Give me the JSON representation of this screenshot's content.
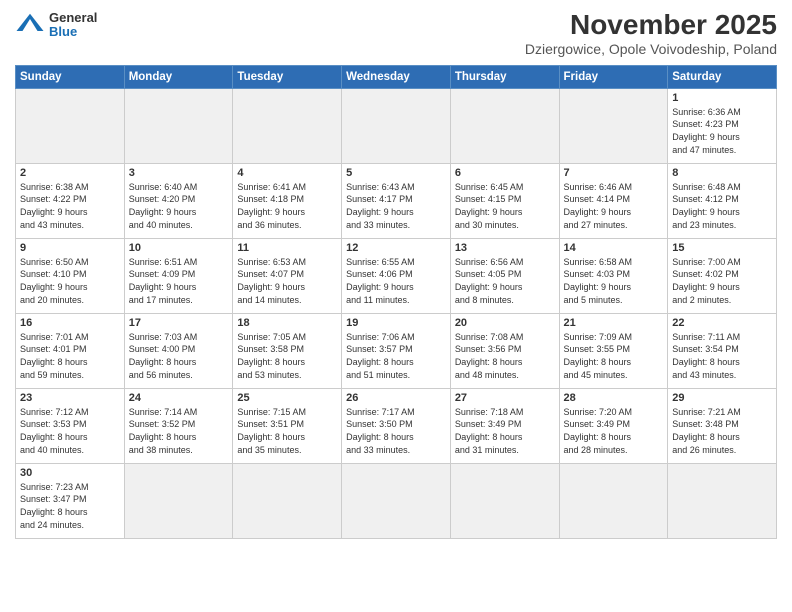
{
  "header": {
    "logo_general": "General",
    "logo_blue": "Blue",
    "month_title": "November 2025",
    "location": "Dziergowice, Opole Voivodeship, Poland"
  },
  "days_of_week": [
    "Sunday",
    "Monday",
    "Tuesday",
    "Wednesday",
    "Thursday",
    "Friday",
    "Saturday"
  ],
  "weeks": [
    {
      "days": [
        {
          "num": "",
          "info": ""
        },
        {
          "num": "",
          "info": ""
        },
        {
          "num": "",
          "info": ""
        },
        {
          "num": "",
          "info": ""
        },
        {
          "num": "",
          "info": ""
        },
        {
          "num": "",
          "info": ""
        },
        {
          "num": "1",
          "info": "Sunrise: 6:36 AM\nSunset: 4:23 PM\nDaylight: 9 hours\nand 47 minutes."
        }
      ]
    },
    {
      "days": [
        {
          "num": "2",
          "info": "Sunrise: 6:38 AM\nSunset: 4:22 PM\nDaylight: 9 hours\nand 43 minutes."
        },
        {
          "num": "3",
          "info": "Sunrise: 6:40 AM\nSunset: 4:20 PM\nDaylight: 9 hours\nand 40 minutes."
        },
        {
          "num": "4",
          "info": "Sunrise: 6:41 AM\nSunset: 4:18 PM\nDaylight: 9 hours\nand 36 minutes."
        },
        {
          "num": "5",
          "info": "Sunrise: 6:43 AM\nSunset: 4:17 PM\nDaylight: 9 hours\nand 33 minutes."
        },
        {
          "num": "6",
          "info": "Sunrise: 6:45 AM\nSunset: 4:15 PM\nDaylight: 9 hours\nand 30 minutes."
        },
        {
          "num": "7",
          "info": "Sunrise: 6:46 AM\nSunset: 4:14 PM\nDaylight: 9 hours\nand 27 minutes."
        },
        {
          "num": "8",
          "info": "Sunrise: 6:48 AM\nSunset: 4:12 PM\nDaylight: 9 hours\nand 23 minutes."
        }
      ]
    },
    {
      "days": [
        {
          "num": "9",
          "info": "Sunrise: 6:50 AM\nSunset: 4:10 PM\nDaylight: 9 hours\nand 20 minutes."
        },
        {
          "num": "10",
          "info": "Sunrise: 6:51 AM\nSunset: 4:09 PM\nDaylight: 9 hours\nand 17 minutes."
        },
        {
          "num": "11",
          "info": "Sunrise: 6:53 AM\nSunset: 4:07 PM\nDaylight: 9 hours\nand 14 minutes."
        },
        {
          "num": "12",
          "info": "Sunrise: 6:55 AM\nSunset: 4:06 PM\nDaylight: 9 hours\nand 11 minutes."
        },
        {
          "num": "13",
          "info": "Sunrise: 6:56 AM\nSunset: 4:05 PM\nDaylight: 9 hours\nand 8 minutes."
        },
        {
          "num": "14",
          "info": "Sunrise: 6:58 AM\nSunset: 4:03 PM\nDaylight: 9 hours\nand 5 minutes."
        },
        {
          "num": "15",
          "info": "Sunrise: 7:00 AM\nSunset: 4:02 PM\nDaylight: 9 hours\nand 2 minutes."
        }
      ]
    },
    {
      "days": [
        {
          "num": "16",
          "info": "Sunrise: 7:01 AM\nSunset: 4:01 PM\nDaylight: 8 hours\nand 59 minutes."
        },
        {
          "num": "17",
          "info": "Sunrise: 7:03 AM\nSunset: 4:00 PM\nDaylight: 8 hours\nand 56 minutes."
        },
        {
          "num": "18",
          "info": "Sunrise: 7:05 AM\nSunset: 3:58 PM\nDaylight: 8 hours\nand 53 minutes."
        },
        {
          "num": "19",
          "info": "Sunrise: 7:06 AM\nSunset: 3:57 PM\nDaylight: 8 hours\nand 51 minutes."
        },
        {
          "num": "20",
          "info": "Sunrise: 7:08 AM\nSunset: 3:56 PM\nDaylight: 8 hours\nand 48 minutes."
        },
        {
          "num": "21",
          "info": "Sunrise: 7:09 AM\nSunset: 3:55 PM\nDaylight: 8 hours\nand 45 minutes."
        },
        {
          "num": "22",
          "info": "Sunrise: 7:11 AM\nSunset: 3:54 PM\nDaylight: 8 hours\nand 43 minutes."
        }
      ]
    },
    {
      "days": [
        {
          "num": "23",
          "info": "Sunrise: 7:12 AM\nSunset: 3:53 PM\nDaylight: 8 hours\nand 40 minutes."
        },
        {
          "num": "24",
          "info": "Sunrise: 7:14 AM\nSunset: 3:52 PM\nDaylight: 8 hours\nand 38 minutes."
        },
        {
          "num": "25",
          "info": "Sunrise: 7:15 AM\nSunset: 3:51 PM\nDaylight: 8 hours\nand 35 minutes."
        },
        {
          "num": "26",
          "info": "Sunrise: 7:17 AM\nSunset: 3:50 PM\nDaylight: 8 hours\nand 33 minutes."
        },
        {
          "num": "27",
          "info": "Sunrise: 7:18 AM\nSunset: 3:49 PM\nDaylight: 8 hours\nand 31 minutes."
        },
        {
          "num": "28",
          "info": "Sunrise: 7:20 AM\nSunset: 3:49 PM\nDaylight: 8 hours\nand 28 minutes."
        },
        {
          "num": "29",
          "info": "Sunrise: 7:21 AM\nSunset: 3:48 PM\nDaylight: 8 hours\nand 26 minutes."
        }
      ]
    },
    {
      "days": [
        {
          "num": "30",
          "info": "Sunrise: 7:23 AM\nSunset: 3:47 PM\nDaylight: 8 hours\nand 24 minutes."
        },
        {
          "num": "",
          "info": ""
        },
        {
          "num": "",
          "info": ""
        },
        {
          "num": "",
          "info": ""
        },
        {
          "num": "",
          "info": ""
        },
        {
          "num": "",
          "info": ""
        },
        {
          "num": "",
          "info": ""
        }
      ]
    }
  ]
}
